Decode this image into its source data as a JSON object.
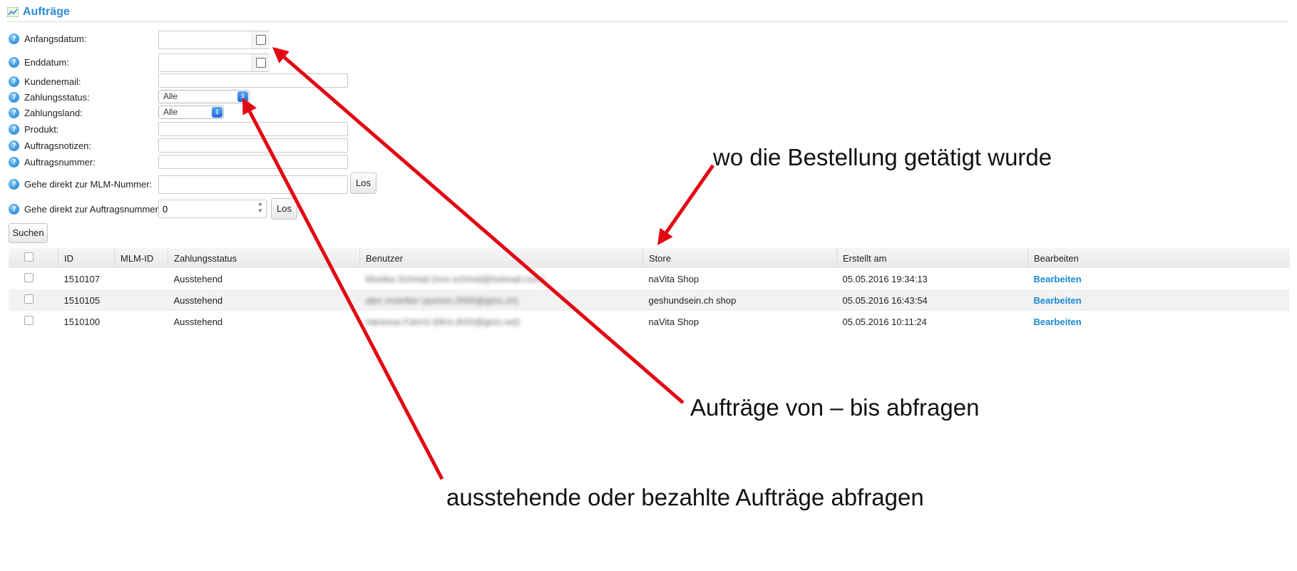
{
  "header": {
    "title": "Aufträge"
  },
  "filters": {
    "start_date_label": "Anfangsdatum:",
    "end_date_label": "Enddatum:",
    "customer_email_label": "Kundenemail:",
    "payment_status_label": "Zahlungsstatus:",
    "payment_status_value": "Alle",
    "payment_country_label": "Zahlungsland:",
    "payment_country_value": "Alle",
    "product_label": "Produkt:",
    "order_notes_label": "Auftragsnotizen:",
    "order_number_label": "Auftragsnummer:",
    "goto_mlm_label": "Gehe direkt zur MLM-Nummer:",
    "goto_mlm_button": "Los",
    "goto_order_label": "Gehe direkt zur Auftragsnummer:",
    "goto_order_value": "0",
    "goto_order_button": "Los",
    "search_button": "Suchen"
  },
  "table": {
    "columns": [
      "ID",
      "MLM-ID",
      "Zahlungsstatus",
      "Benutzer",
      "Store",
      "Erstellt am",
      "Bearbeiten"
    ],
    "rows": [
      {
        "id": "1510107",
        "mlm_id": "",
        "status": "Ausstehend",
        "user": "Monika Schmid (mm.schmid@hotmail.com)",
        "store": "naVita Shop",
        "created": "05.05.2016 19:34:13",
        "edit": "Bearbeiten"
      },
      {
        "id": "1510105",
        "mlm_id": "",
        "status": "Ausstehend",
        "user": "alex moerker (aomes.2000@gmx.ch)",
        "store": "geshundsein.ch shop",
        "created": "05.05.2016 16:43:54",
        "edit": "Bearbeiten"
      },
      {
        "id": "1510100",
        "mlm_id": "",
        "status": "Ausstehend",
        "user": "Vanessa Fahrni (bfrm.th50@gmx.net)",
        "store": "naVita Shop",
        "created": "05.05.2016 10:11:24",
        "edit": "Bearbeiten"
      }
    ]
  },
  "annotations": {
    "store_note": "wo die Bestellung getätigt wurde",
    "date_note": "Aufträge von – bis abfragen",
    "status_note": "ausstehende oder bezahlte Aufträge abfragen",
    "arrow_color": "#e30613"
  }
}
